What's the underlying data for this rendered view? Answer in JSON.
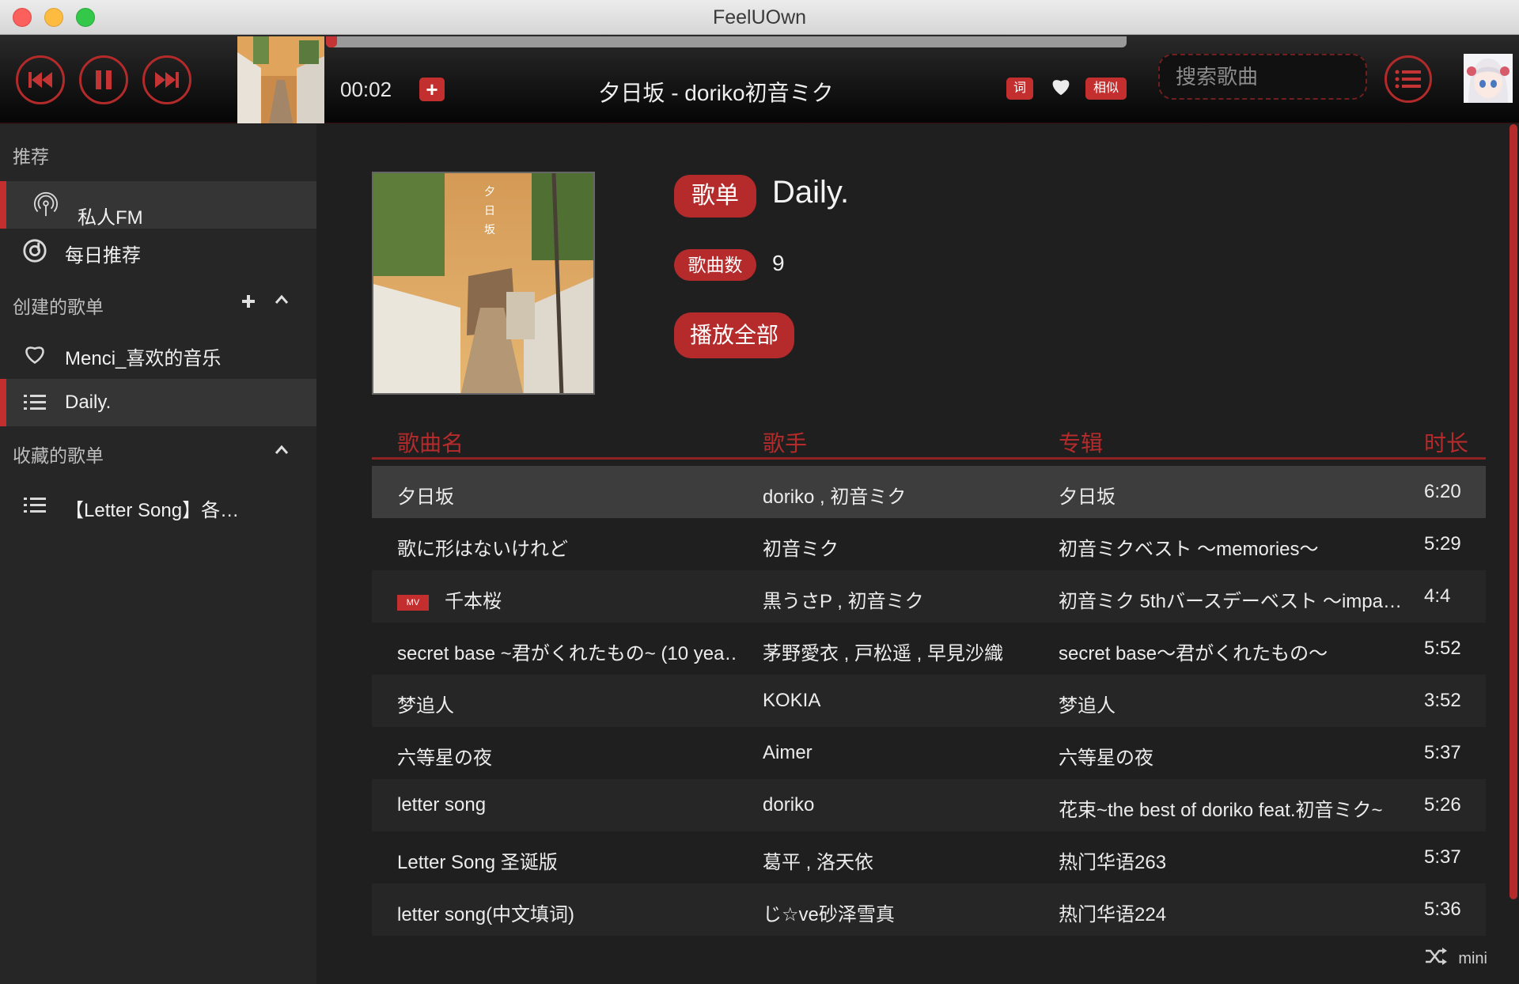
{
  "window": {
    "title": "FeelUOwn"
  },
  "player": {
    "time": "00:02",
    "add_label": "+",
    "now_playing": "夕日坂 - doriko初音ミク",
    "lyrics_label": "词",
    "similar_label": "相似",
    "progress": 0.014,
    "accent": "#c32f2f"
  },
  "search": {
    "placeholder": "搜索歌曲",
    "value": ""
  },
  "sidebar": {
    "recommend_header": "推荐",
    "fm_label": "私人FM",
    "daily_label": "每日推荐",
    "created_header": "创建的歌单",
    "created": [
      {
        "label": "Menci_喜欢的音乐",
        "icon": "heart-icon"
      },
      {
        "label": "Daily.",
        "icon": "list-icon"
      }
    ],
    "collected_header": "收藏的歌单",
    "collected": [
      {
        "label": "【Letter Song】各…",
        "icon": "list-icon"
      }
    ]
  },
  "playlist": {
    "type_label": "歌单",
    "name": "Daily.",
    "count_label": "歌曲数",
    "count": "9",
    "play_all_label": "播放全部"
  },
  "table": {
    "headers": [
      "歌曲名",
      "歌手",
      "专辑",
      "时长"
    ],
    "rows": [
      {
        "title": "夕日坂",
        "artist": "doriko , 初音ミク",
        "album": "夕日坂",
        "duration": "6:20",
        "mv": false
      },
      {
        "title": "歌に形はないけれど",
        "artist": "初音ミク",
        "album": "初音ミクベスト ～memories～",
        "duration": "5:29",
        "mv": false
      },
      {
        "title": "千本桜",
        "artist": "黒うさP , 初音ミク",
        "album": "初音ミク 5thバースデーベスト ～impa…",
        "duration": "4:4",
        "mv": true,
        "mv_label": "MV"
      },
      {
        "title": "secret base ~君がくれたもの~ (10 yea…",
        "artist": "茅野愛衣 , 戸松遥 , 早見沙織",
        "album": "secret base～君がくれたもの～",
        "duration": "5:52",
        "mv": false
      },
      {
        "title": "梦追人",
        "artist": "KOKIA",
        "album": "梦追人",
        "duration": "3:52",
        "mv": false
      },
      {
        "title": "六等星の夜",
        "artist": "Aimer",
        "album": "六等星の夜",
        "duration": "5:37",
        "mv": false
      },
      {
        "title": "letter song",
        "artist": "doriko",
        "album": "花束~the best of doriko feat.初音ミク~",
        "duration": "5:26",
        "mv": false
      },
      {
        "title": "Letter Song 圣诞版",
        "artist": "葛平 , 洛天依",
        "album": "热门华语263",
        "duration": "5:37",
        "mv": false
      },
      {
        "title": "letter song(中文填词)",
        "artist": "じ☆ve砂泽雪真",
        "album": "热门华语224",
        "duration": "5:36",
        "mv": false
      }
    ]
  },
  "footer": {
    "mini_label": "mini"
  }
}
